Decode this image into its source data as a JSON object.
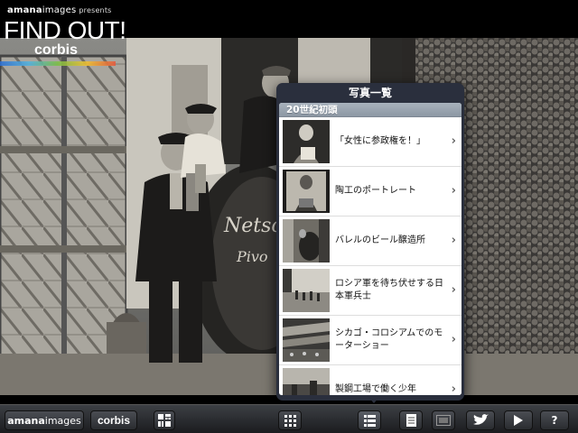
{
  "brand": {
    "amana_prefix": "amana",
    "amana_suffix": "images",
    "presents": "presents",
    "findout": "FIND OUT!",
    "corbis": "corbis"
  },
  "popover": {
    "title": "写真一覧",
    "section": "20世紀初頭",
    "items": [
      {
        "label": "「女性に参政権を！」"
      },
      {
        "label": "陶工のポートレート"
      },
      {
        "label": "バレルのビール醸造所"
      },
      {
        "label": "ロシア軍を待ち伏せする日本軍兵士"
      },
      {
        "label": "シカゴ・コロシアムでのモーターショー"
      },
      {
        "label": "製鋼工場で働く少年"
      }
    ]
  },
  "toolbar": {
    "amana_prefix": "amana",
    "amana_suffix": "images",
    "corbis": "corbis",
    "help": "?"
  },
  "icons": {
    "mosaic": "mosaic-icon",
    "grid": "grid-icon",
    "list": "list-icon",
    "document": "document-icon",
    "slides": "slides-icon",
    "twitter": "twitter-bird-icon",
    "play": "play-icon"
  }
}
